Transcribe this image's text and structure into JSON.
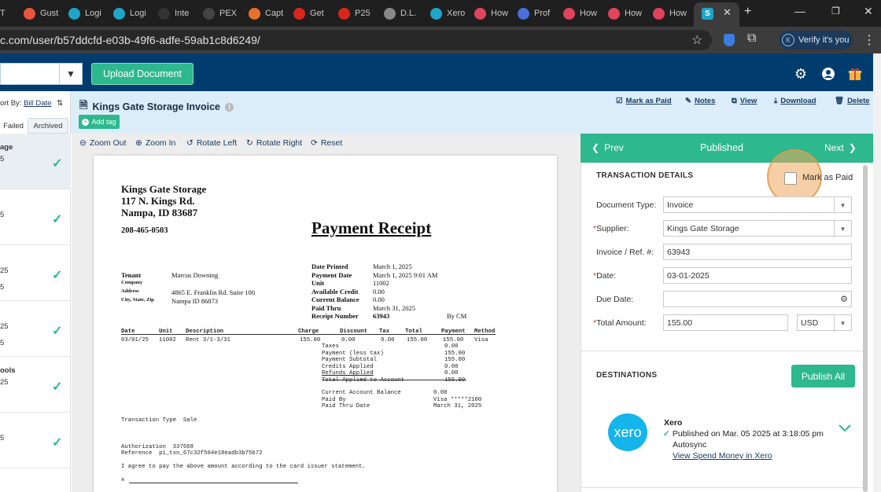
{
  "browser": {
    "tabs": [
      {
        "label": "T",
        "icon": "generic-tab-icon",
        "color": "#555555"
      },
      {
        "label": "Gust",
        "icon": "gusto-icon",
        "color": "#e8553f"
      },
      {
        "label": "Logi",
        "icon": "app-logo-icon",
        "color": "#1ea5c8"
      },
      {
        "label": "Logi",
        "icon": "app-logo-icon",
        "color": "#1ea5c8"
      },
      {
        "label": "Inte",
        "icon": "b-icon",
        "color": "#333333"
      },
      {
        "label": "PEX",
        "icon": "pex-icon",
        "color": "#444444"
      },
      {
        "label": "Capt",
        "icon": "capterra-icon",
        "color": "#e8712c"
      },
      {
        "label": "Get",
        "icon": "acrobat-icon",
        "color": "#d9261c"
      },
      {
        "label": "P25",
        "icon": "pdf-icon",
        "color": "#d9261c"
      },
      {
        "label": "D.L.",
        "icon": "globe-icon",
        "color": "#888888"
      },
      {
        "label": "Xero",
        "icon": "app-logo-icon",
        "color": "#1ea5c8"
      },
      {
        "label": "How",
        "icon": "scribe-icon",
        "color": "#e0435b"
      },
      {
        "label": "Prof",
        "icon": "grid-icon",
        "color": "#4a6fd8"
      },
      {
        "label": "How",
        "icon": "scribe-icon",
        "color": "#e0435b"
      },
      {
        "label": "How",
        "icon": "scribe-icon",
        "color": "#e0435b"
      },
      {
        "label": "How",
        "icon": "scribe-icon",
        "color": "#e0435b"
      }
    ],
    "active_tab_icon": "active-tab-icon",
    "url": "c.com/user/b57ddcfd-e03b-49f6-adfe-59ab1c8d6249/",
    "verify_label": "Verify it's you",
    "profile_initial": "K"
  },
  "header": {
    "upload_label": "Upload Document",
    "icons": [
      "gear-icon",
      "user-icon",
      "gift-icon"
    ]
  },
  "left": {
    "sort_prefix": "ort By: ",
    "sort_value": "Bill Date",
    "filters": [
      "Failed",
      "Archived"
    ],
    "items": [
      {
        "l1": "age",
        "l2": "5",
        "l3": ""
      },
      {
        "l1": "",
        "l2": "5",
        "l3": ""
      },
      {
        "l1": "",
        "l2": "25",
        "l3": "5"
      },
      {
        "l1": "",
        "l2": "25",
        "l3": "5"
      },
      {
        "l1": "ools",
        "l2": "25",
        "l3": ""
      },
      {
        "l1": "",
        "l2": "5",
        "l3": ""
      }
    ]
  },
  "document": {
    "title": "Kings Gate Storage Invoice",
    "add_tag_label": "Add tag",
    "actions": [
      {
        "label": "Mark as Paid",
        "icon": "check-square-icon"
      },
      {
        "label": "Notes",
        "icon": "edit-icon"
      },
      {
        "label": "View",
        "icon": "external-link-icon"
      },
      {
        "label": "Download",
        "icon": "download-icon"
      },
      {
        "label": "Delete",
        "icon": "trash-icon"
      }
    ]
  },
  "viewer": {
    "buttons": [
      {
        "label": "Zoom Out",
        "icon": "zoom-out-icon"
      },
      {
        "label": "Zoom In",
        "icon": "zoom-in-icon"
      },
      {
        "label": "Rotate Left",
        "icon": "rotate-left-icon"
      },
      {
        "label": "Rotate Right",
        "icon": "rotate-right-icon"
      },
      {
        "label": "Reset",
        "icon": "reset-icon"
      }
    ]
  },
  "receipt": {
    "company": "Kings Gate Storage",
    "addr1": "117 N. Kings Rd.",
    "addr2": "Nampa, ID  83687",
    "phone": "208-465-0503",
    "heading": "Payment Receipt",
    "left_labels": [
      "Tenant",
      "Company",
      "Address",
      "City, State, Zip"
    ],
    "left_values": [
      "Marcus Downing",
      "",
      "4865 E. Franklin Rd. Suite 100",
      "Nampa  ID  86873"
    ],
    "right_labels": [
      "Date Printed",
      "Payment Date",
      "Unit",
      "Available Credit",
      "Current Balance",
      "Paid Thru",
      "Receipt Number"
    ],
    "right_values": [
      "March 1, 2025",
      "March 1, 2025 9:01 AM",
      "11002",
      "0.00",
      "0.00",
      "March 31, 2025",
      "63943"
    ],
    "by": "By CM",
    "table_headers": [
      "Date",
      "Unit",
      "Description",
      "Charge",
      "Discount",
      "Tax",
      "Total",
      "Payment",
      "Method"
    ],
    "table_row": [
      "03/01/25",
      "11002",
      "Rent 3/1-3/31",
      "155.00",
      "0.00",
      "0.00",
      "155.00",
      "155.00",
      "Visa"
    ],
    "summary_labels": [
      "Taxes",
      "Payment (less tax)",
      "Payment Subtotal",
      "Credits Applied",
      "Refunds Applied",
      "Total Applied to Account"
    ],
    "summary_values": [
      "0.00",
      "155.00",
      "155.00",
      "0.00",
      "0.00",
      "155.00"
    ],
    "balance_labels": [
      "Current Account Balance",
      "Paid By",
      "Paid Thru Date"
    ],
    "balance_values": [
      "0.00",
      "Visa *****2100",
      "March 31, 2025"
    ],
    "transaction_type": "Transaction Type  Sale",
    "authorization": "Authorization  337668",
    "reference": "Reference  pi_txn_67c32f504e18eadb3b75b72",
    "agree": "I agree to pay the above amount according to the card issuer statement.",
    "sign_prefix": "x"
  },
  "details": {
    "prev": "Prev",
    "status": "Published",
    "next": "Next",
    "section": "TRANSACTION DETAILS",
    "mark_as_paid": "Mark as Paid",
    "doc_type_label": "Document Type:",
    "doc_type": "Invoice",
    "supplier_label": "Supplier:",
    "supplier": "Kings Gate Storage",
    "invoice_label": "Invoice / Ref. #:",
    "invoice": "63943",
    "date_label": "Date:",
    "date": "03-01-2025",
    "due_label": "Due Date:",
    "due": "",
    "total_label": "Total Amount:",
    "total": "155.00",
    "currency": "USD",
    "destinations": "DESTINATIONS",
    "publish_all": "Publish All",
    "xero_logo": "xero",
    "xero_name": "Xero",
    "published_on": "Published on Mar. 05 2025 at 3:18:05 pm",
    "autosync": "Autosync",
    "view_link": "View Spend Money in Xero"
  },
  "colors": {
    "brand_navy": "#003c6e",
    "accent_green": "#2db88d",
    "toolbar_blue": "#dbedf9",
    "xero_blue": "#13b5ea",
    "highlight_orange": "#f0a85c"
  }
}
